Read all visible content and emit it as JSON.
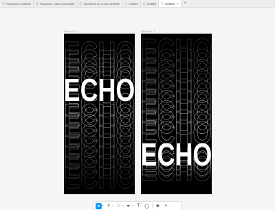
{
  "tabs": [
    {
      "label": "Polypoints (Untitled)",
      "icon": "file-icon",
      "active": false
    },
    {
      "label": "Playhouse Fallout (example)",
      "icon": "file-icon",
      "active": false
    },
    {
      "label": "Wireframe of a Good Website",
      "icon": "file-icon",
      "active": false
    },
    {
      "label": "Untitled",
      "icon": "file-icon",
      "active": false
    },
    {
      "label": "Untitled",
      "icon": "file-icon",
      "active": false
    },
    {
      "label": "Untitled",
      "icon": "file-icon",
      "active": true
    }
  ],
  "frames": {
    "left": {
      "label": "iPhone 14 - 1",
      "word": "ECHO"
    },
    "right": {
      "label": "iPhone 14 - 2",
      "word": "ECHO"
    }
  },
  "toolbar": {
    "tools": [
      "move-tool",
      "frame-tool",
      "shape-tool",
      "pen-tool",
      "text-tool",
      "comment-tool",
      "actions-tool",
      "dev-mode-tool"
    ],
    "active_tool": "move-tool"
  },
  "colors": {
    "accent": "#0d99ff",
    "frame_bg": "#000000",
    "text": "#ffffff"
  }
}
